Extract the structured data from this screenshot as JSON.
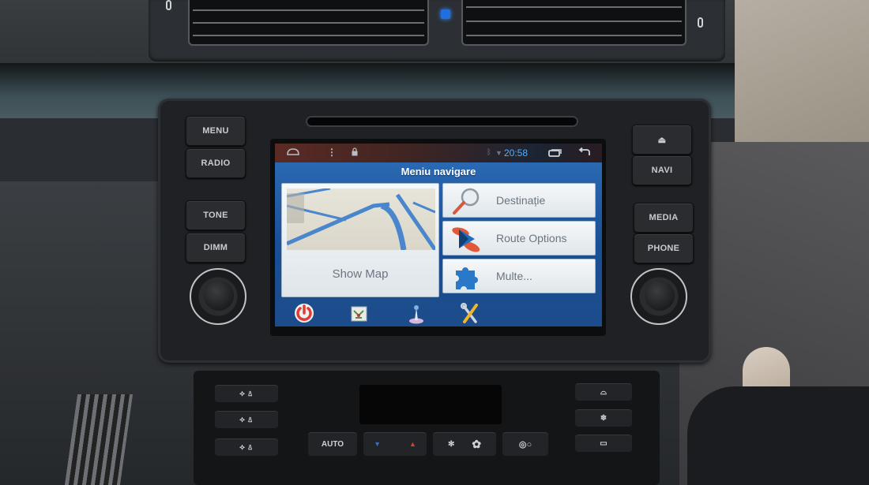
{
  "dashboard": {
    "vent_indicator_color": "#1f6fe0"
  },
  "head_unit": {
    "left_buttons": [
      {
        "id": "menu",
        "label": "MENU"
      },
      {
        "id": "radio",
        "label": "RADIO"
      },
      {
        "id": "tone",
        "label": "TONE"
      },
      {
        "id": "dimm",
        "label": "DIMM"
      }
    ],
    "right_buttons": [
      {
        "id": "eject",
        "label": "⏏",
        "icon": "eject-icon"
      },
      {
        "id": "navi",
        "label": "NAVI"
      },
      {
        "id": "media",
        "label": "MEDIA"
      },
      {
        "id": "phone",
        "label": "PHONE"
      }
    ],
    "knobs": [
      "volume-knob",
      "tune-knob"
    ]
  },
  "screen": {
    "status_bar": {
      "home_icon": "home-icon",
      "menu_icon": "overflow-menu-icon",
      "notification_icon": "lock-icon",
      "signal_icons": [
        "bluetooth-icon",
        "wifi-icon"
      ],
      "time": "20:58",
      "recent_apps_icon": "recent-apps-icon",
      "back_icon": "back-icon",
      "time_color": "#4fb0ff"
    },
    "title": "Meniu navigare",
    "map_tile": {
      "label": "Show Map"
    },
    "menu_items": [
      {
        "label": "Destinație",
        "icon": "magnifier-icon"
      },
      {
        "label": "Route Options",
        "icon": "route-options-icon"
      },
      {
        "label": "Multe...",
        "icon": "puzzle-icon"
      }
    ],
    "dock": [
      {
        "name": "power",
        "icon": "power-icon"
      },
      {
        "name": "map-view",
        "icon": "map-view-icon"
      },
      {
        "name": "route-info",
        "icon": "route-info-icon"
      },
      {
        "name": "settings",
        "icon": "tools-icon"
      }
    ],
    "accent_color": "#2e6fb9"
  },
  "climate": {
    "auto_label": "AUTO",
    "buttons_left": [
      "air-flow-upper-icon",
      "air-flow-middle-icon",
      "air-flow-lower-icon"
    ],
    "buttons_right": [
      "front-defrost-icon",
      "ac-icon",
      "rear-defrost-icon"
    ],
    "temp_down_icon": "temp-down-icon",
    "temp_up_icon": "temp-up-icon",
    "fan_low_icon": "fan-low-icon",
    "fan_high_icon": "fan-high-icon",
    "recirculation_icon": "recirculation-icon"
  }
}
